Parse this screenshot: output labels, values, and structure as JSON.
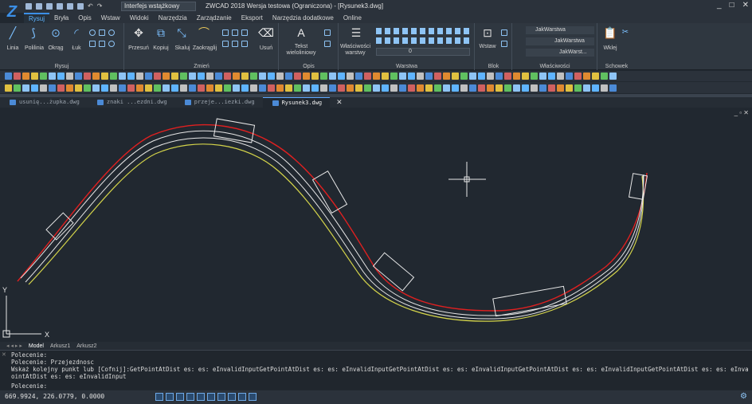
{
  "title": {
    "workspace": "Interfejs wstążkowy",
    "window": "ZWCAD 2018 Wersja testowa (Ograniczona) - [Rysunek3.dwg]"
  },
  "menus": [
    "Rysuj",
    "Bryła",
    "Opis",
    "Wstaw",
    "Widoki",
    "Narzędzia",
    "Zarządzanie",
    "Eksport",
    "Narzędzia dodatkowe",
    "Online"
  ],
  "ribbon": {
    "rysuj": {
      "title": "Rysuj",
      "linia": "Linia",
      "polilinia": "Polilinia",
      "okrag": "Okrąg",
      "luk": "Łuk"
    },
    "zmien": {
      "title": "Zmień",
      "przesun": "Przesuń",
      "kopiuj": "Kopiuj",
      "skaluj": "Skaluj",
      "zaokraglij": "Zaokrąglij",
      "usun": "Usuń"
    },
    "opis": {
      "title": "Opis",
      "tekst": "Tekst wieloliniowy"
    },
    "warstwa": {
      "title": "Warstwa",
      "wlasciwosci": "Właściwości warstwy",
      "layer_value": "0"
    },
    "blok": {
      "title": "Blok",
      "wstaw": "Wstaw"
    },
    "wlasciwosci": {
      "title": "Właściwości",
      "color": "JakWarstwa",
      "linetype": "JakWarstwa",
      "lineweight": "JakWarst..."
    },
    "schowek": {
      "title": "Schowek",
      "wklej": "Wklej"
    }
  },
  "doc_tabs": [
    "usunię...żupka.dwg",
    "znaki ...ezdni.dwg",
    "przeje...iezki.dwg",
    "Rysunek3.dwg"
  ],
  "layout_tabs": [
    "Model",
    "Arkusz1",
    "Arkusz2"
  ],
  "ucs": {
    "x": "X",
    "y": "Y"
  },
  "command_lines": [
    "Polecenie:",
    "Polecenie: Przejezdnosc",
    "Wskaż kolejny punkt lub  [Cofnij]:GetPointAtDist es:  es: eInvalidInputGetPointAtDist es:  es: eInvalidInputGetPointAtDist es:  es: eInvalidInputGetPointAtDist es:  es: eInvalidInputGetPointAtDist es:  es: eInvalidInputGetP",
    "ointAtDist es:  es: eInvalidInput",
    "Polecenie:"
  ],
  "status": {
    "coords": "669.9924, 226.0779, 0.0000"
  },
  "colors": {
    "accent": "#3b8fe6",
    "background": "#212830",
    "yellow_line": "#d4d44a",
    "red_line": "#e02020",
    "white_line": "#e8e8e8"
  }
}
